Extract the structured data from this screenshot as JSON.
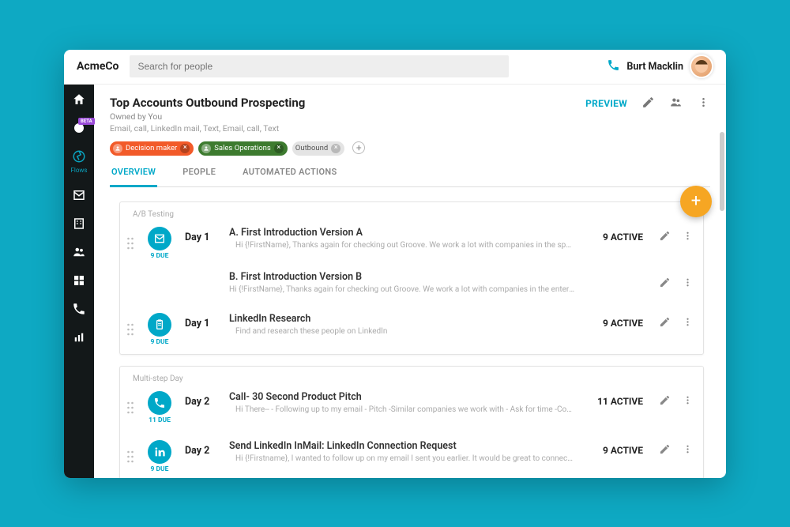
{
  "brand": "AcmeCo",
  "search_placeholder": "Search for people",
  "user_name": "Burt Macklin",
  "sidebar": {
    "active_label": "Flows",
    "beta_badge": "BETA"
  },
  "header": {
    "title": "Top Accounts Outbound Prospecting",
    "owner": "Owned by You",
    "channels": "Email, call, LinkedIn mail, Text, Email, call, Text",
    "preview": "PREVIEW",
    "chips": [
      {
        "label": "Decision maker",
        "color": "orange",
        "has_person": true
      },
      {
        "label": "Sales Operations",
        "color": "green",
        "has_person": true
      },
      {
        "label": "Outbound",
        "color": "gray",
        "has_person": false
      }
    ]
  },
  "tabs": [
    "OVERVIEW",
    "PEOPLE",
    "AUTOMATED ACTIONS"
  ],
  "sections": [
    {
      "label": "A/B Testing",
      "steps": [
        {
          "icon": "mail",
          "due": "9 DUE",
          "day": "Day 1",
          "title": "A. First Introduction Version A",
          "sub": "Hi {!FirstName}, Thanks again for checking out Groove. We work a lot with companies in the  space, and I …",
          "active": "9 ACTIVE",
          "variants": [
            {
              "title": "B. First Introduction Version B",
              "sub": "Hi {!FirstName}, Thanks again for checking out Groove. We work a lot with companies in the enterprise sp…"
            }
          ]
        },
        {
          "icon": "clipboard",
          "due": "9 DUE",
          "day": "Day 1",
          "title": "LinkedIn Research",
          "sub": "Find and research these people on LinkedIn",
          "active": "9 ACTIVE",
          "variants": []
        }
      ]
    },
    {
      "label": "Multi-step Day",
      "steps": [
        {
          "icon": "phone",
          "due": "11 DUE",
          "day": "Day 2",
          "title": "Call- 30 Second Product Pitch",
          "sub": "Hi There-- - Following up to my email - Pitch -Similar companies we work with - Ask for time -Confirm & S…",
          "active": "11 ACTIVE",
          "variants": []
        },
        {
          "icon": "linkedin",
          "due": "9 DUE",
          "day": "Day 2",
          "title": "Send LinkedIn InMail: LinkedIn Connection Request",
          "sub": "Hi {!Firstname}, I wanted to follow up on my email I sent you earlier. It would be great to connect on a quic…",
          "active": "9 ACTIVE",
          "variants": []
        }
      ]
    }
  ]
}
